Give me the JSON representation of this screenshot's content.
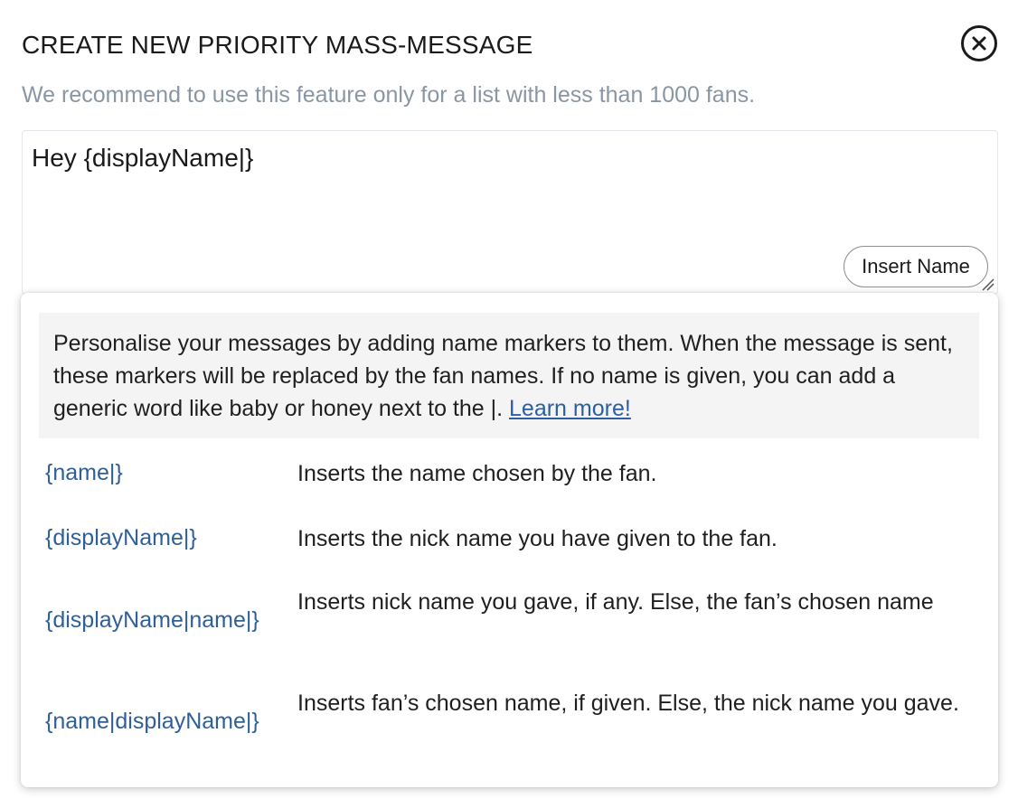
{
  "dialog": {
    "title": "CREATE NEW PRIORITY MASS-MESSAGE",
    "subtitle": "We recommend to use this feature only for a list with less than 1000 fans.",
    "close_icon": "close-circle-icon"
  },
  "composer": {
    "message": "Hey {displayName|}",
    "insert_name_label": "Insert Name"
  },
  "popup": {
    "info_text": "Personalise your messages by adding name markers to them. When the message is sent, these markers will be replaced by the fan names. If no name is given, you can add a generic word like baby or honey next to the |. ",
    "learn_more": "Learn more!",
    "markers": [
      {
        "token": "{name|}",
        "description": "Inserts the name chosen by the fan."
      },
      {
        "token": "{displayName|}",
        "description": "Inserts the nick name you have given to the fan."
      },
      {
        "token": "{displayName|name|}",
        "description": "Inserts nick name you gave, if any. Else, the fan’s chosen name"
      },
      {
        "token": "{name|displayName|}",
        "description": "Inserts fan’s chosen name, if given. Else, the nick name you gave."
      }
    ]
  },
  "colors": {
    "link": "#2c5fa1",
    "token": "#2f5f99",
    "subtitle": "#8a96a3",
    "info_bg": "#f4f4f4"
  }
}
